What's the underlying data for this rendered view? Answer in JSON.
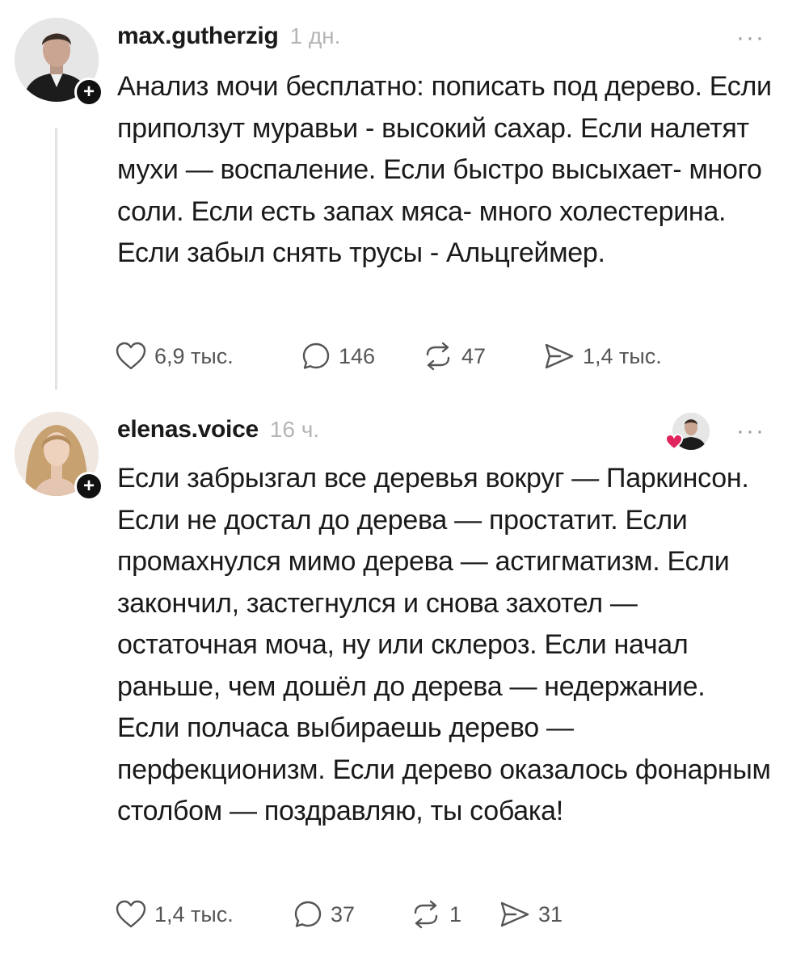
{
  "posts": [
    {
      "username": "max.gutherzig",
      "time": "1 дн.",
      "more_label": "···",
      "avatar_icon": "user-photo-male",
      "text": "Анализ мочи бесплатно: пописать под дерево. Если приползут муравьи - высокий сахар. Если налетят мухи — воспаление. Если быстро высыхает- много соли. Если есть запах мяса- много холестерина. Если забыл снять трусы - Альцгеймер.",
      "likes": "6,9 тыс.",
      "comments": "146",
      "reposts": "47",
      "shares": "1,4 тыс."
    },
    {
      "username": "elenas.voice",
      "time": "16 ч.",
      "more_label": "···",
      "avatar_icon": "user-photo-female",
      "liked_by_icon": "liked-by-author-avatar",
      "text": "Если забрызгал все деревья вокруг — Паркинсон. Если не достал до дерева — простатит.  Если промахнулся мимо дерева — астигматизм.  Если закончил, застегнулся и снова захотел — остаточная моча, ну или склероз. Если начал раньше, чем дошёл до дерева — недержание. Если полчаса выбираешь дерево — перфекционизм. Если дерево оказалось фонарным столбом — поздравляю, ты собака!",
      "likes": "1,4 тыс.",
      "comments": "37",
      "reposts": "1",
      "shares": "31"
    }
  ],
  "colors": {
    "text": "#1a1a1a",
    "muted": "#b5b5b5",
    "icon": "#555555",
    "heart_badge": "#e0245e",
    "thread_line": "#e2e2e2"
  }
}
